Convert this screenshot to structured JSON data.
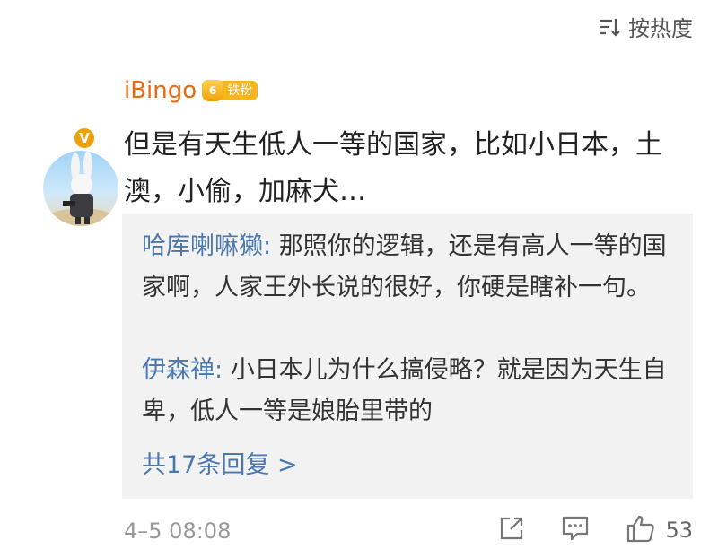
{
  "sort": {
    "label": "按热度",
    "icon": "sort-icon"
  },
  "comment": {
    "username": "iBingo",
    "fan_badge": "铁粉",
    "verified_badge": "V",
    "text": "但是有天生低人一等的国家，比如小日本，土澳，小偷，加麻犬…"
  },
  "replies": [
    {
      "author": "哈库喇嘛獭",
      "separator": ": ",
      "text": "那照你的逻辑，还是有高人一等的国家啊，人家王外长说的很好，你硬是瞎补一句。"
    },
    {
      "author": "伊森禅",
      "separator": ": ",
      "text": "小日本儿为什么搞侵略？就是因为天生自卑，低人一等是娘胎里带的"
    }
  ],
  "view_all_replies": "共17条回复 >",
  "footer": {
    "timestamp": "4–5 08:08",
    "like_count": "53"
  },
  "colors": {
    "username": "#e86b11",
    "reply_author": "#4a77ad",
    "reply_background": "#f2f2f2"
  }
}
